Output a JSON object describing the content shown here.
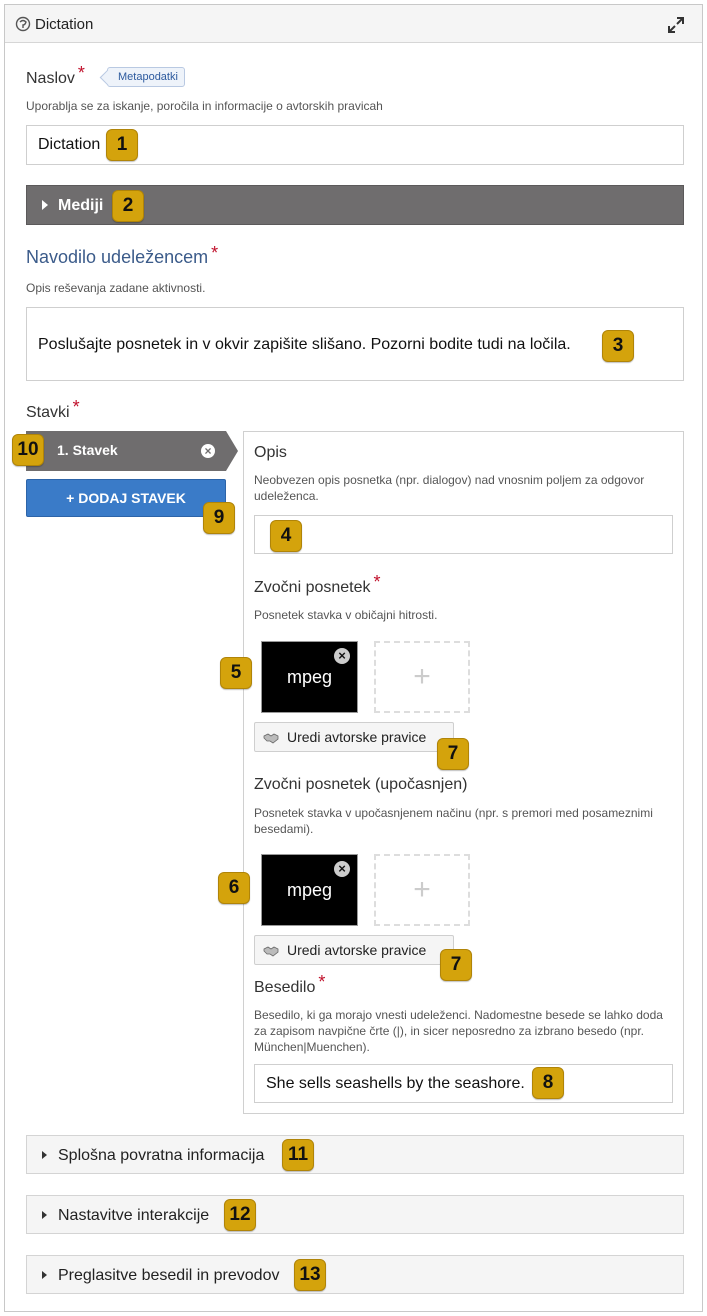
{
  "window": {
    "title": "Dictation",
    "icon": "dictation-icon",
    "expand_icon": "expand-icon"
  },
  "naslov": {
    "label": "Naslov",
    "required": "*",
    "metadata_tag": "Metapodatki",
    "description": "Uporablja se za iskanje, poročila in informacije o avtorskih pravicah",
    "value": "Dictation"
  },
  "media": {
    "label": "Mediji"
  },
  "instructions": {
    "label": "Navodilo udeležencem",
    "required": "*",
    "description": "Opis reševanja zadane aktivnosti.",
    "value": "Poslušajte posnetek in v okvir zapišite slišano. Pozorni bodite tudi na ločila."
  },
  "sentences": {
    "label": "Stavki",
    "required": "*",
    "tabs": [
      {
        "label": "1. Stavek",
        "remove_icon": "remove-icon"
      }
    ],
    "add_button": "+ DODAJ STAVEK",
    "panel": {
      "opis": {
        "label": "Opis",
        "description": "Neobvezen opis posnetka (npr. dialogov) nad vnosnim poljem za odgovor udeleženca.",
        "value": ""
      },
      "audio": {
        "label": "Zvočni posnetek",
        "required": "*",
        "description": "Posnetek stavka v običajni hitrosti.",
        "thumb_label": "mpeg",
        "add_symbol": "+",
        "copyright_button": "Uredi avtorske pravice"
      },
      "audio_slow": {
        "label": "Zvočni posnetek (upočasnjen)",
        "description": "Posnetek stavka v upočasnjenem načinu (npr. s premori med posameznimi besedami).",
        "thumb_label": "mpeg",
        "add_symbol": "+",
        "copyright_button": "Uredi avtorske pravice"
      },
      "besedilo": {
        "label": "Besedilo",
        "required": "*",
        "description": "Besedilo, ki ga morajo vnesti udeleženci. Nadomestne besede se lahko doda za zapisom navpične črte (|), in sicer neposredno za izbrano besedo (npr. München|Muenchen).",
        "value": "She sells seashells by the seashore."
      }
    }
  },
  "collapsibles": [
    {
      "label": "Splošna povratna informacija"
    },
    {
      "label": "Nastavitve interakcije"
    },
    {
      "label": "Preglasitve besedil in prevodov"
    }
  ],
  "badges": [
    "1",
    "2",
    "3",
    "4",
    "5",
    "6",
    "7",
    "7",
    "8",
    "9",
    "10",
    "11",
    "12",
    "13"
  ],
  "colors": {
    "badge": "#d4a30c",
    "accent_blue": "#3a7bc8",
    "required_red": "#c0102b",
    "media_bar": "#6f6d6e",
    "heading_blue": "#3b5b8a"
  }
}
